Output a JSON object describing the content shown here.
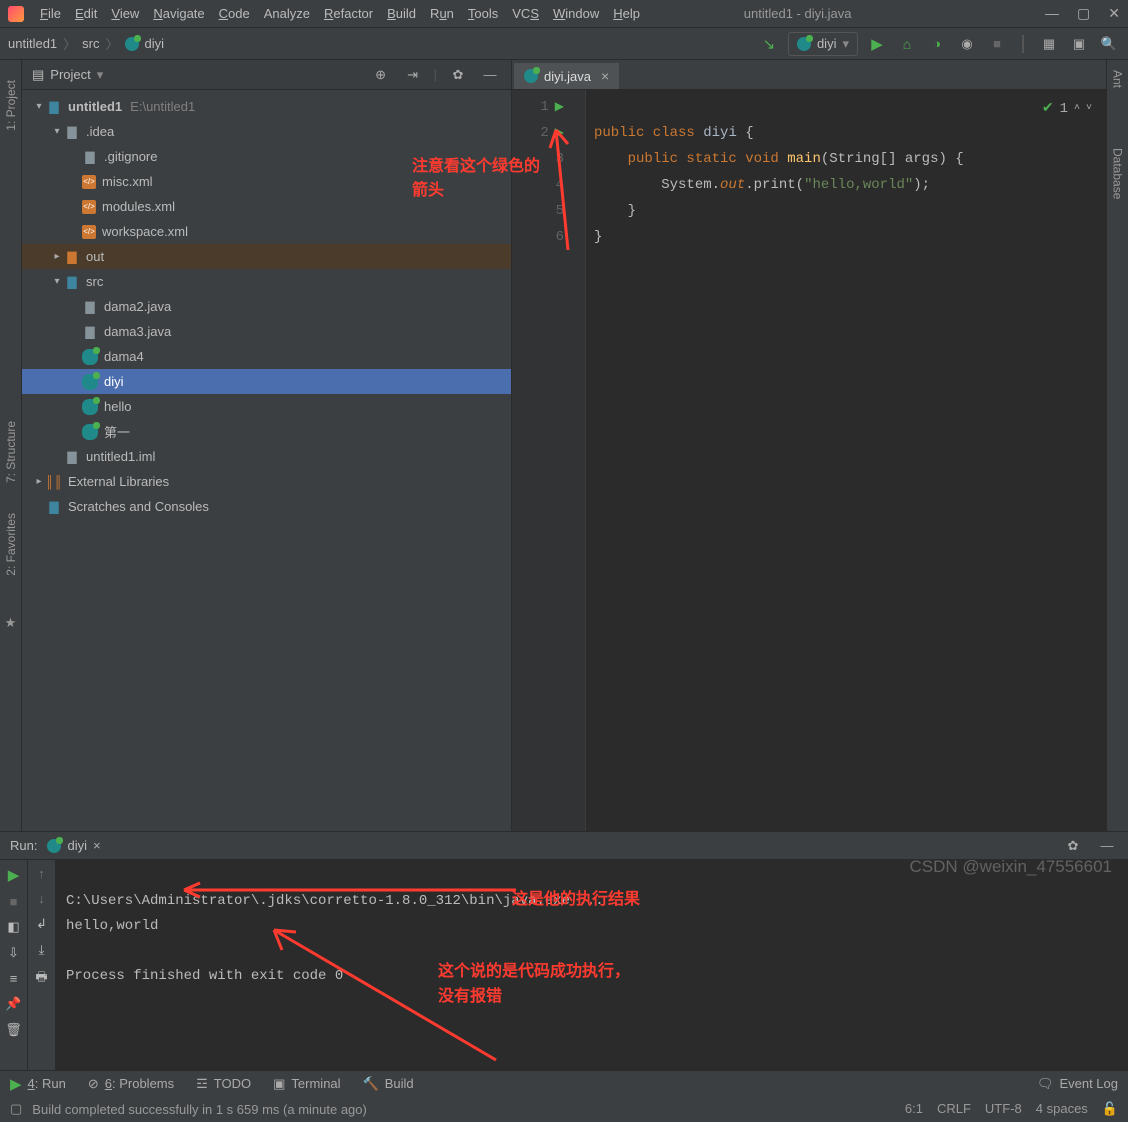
{
  "title_bar": {
    "title": "untitled1 - diyi.java"
  },
  "menus": {
    "file": "File",
    "edit": "Edit",
    "view": "View",
    "navigate": "Navigate",
    "code": "Code",
    "analyze": "Analyze",
    "refactor": "Refactor",
    "build": "Build",
    "run": "Run",
    "tools": "Tools",
    "vcs": "VCS",
    "window": "Window",
    "help": "Help"
  },
  "breadcrumb": {
    "a": "untitled1",
    "b": "src",
    "c": "diyi"
  },
  "run_config": {
    "selected": "diyi"
  },
  "project_panel": {
    "title": "Project"
  },
  "tree": {
    "root": "untitled1",
    "root_path": "E:\\untitled1",
    "idea": ".idea",
    "gitignore": ".gitignore",
    "misc": "misc.xml",
    "modules": "modules.xml",
    "workspace": "workspace.xml",
    "out": "out",
    "src": "src",
    "dama2": "dama2.java",
    "dama3": "dama3.java",
    "dama4": "dama4",
    "diyi": "diyi",
    "hello": "hello",
    "zh": "第一",
    "iml": "untitled1.iml",
    "ext": "External Libraries",
    "scratch": "Scratches and Consoles"
  },
  "tab": {
    "name": "diyi.java"
  },
  "code": {
    "l1": "public class diyi {",
    "l2": "    public static void main(String[] args) {",
    "l3": "        System.out.print(\"hello,world\");",
    "l4": "    }",
    "l5": "}",
    "l6": ""
  },
  "inspection": {
    "count": "1"
  },
  "annotations": {
    "top": "注意看这个绿色的\n箭头",
    "result": "这是他的执行结果",
    "success": "这个说的是代码成功执行，\n没有报错"
  },
  "run_panel": {
    "label": "Run:",
    "tab": "diyi",
    "line1": "C:\\Users\\Administrator\\.jdks\\corretto-1.8.0_312\\bin\\java.exe ...",
    "line2": "hello,world",
    "line3": "",
    "line4": "Process finished with exit code 0"
  },
  "tool_strip": {
    "run": "4: Run",
    "problems": "6: Problems",
    "todo": "TODO",
    "terminal": "Terminal",
    "build": "Build",
    "eventlog": "Event Log"
  },
  "status": {
    "msg": "Build completed successfully in 1 s 659 ms (a minute ago)",
    "pos": "6:1",
    "crlf": "CRLF",
    "enc": "UTF-8",
    "indent": "4 spaces"
  },
  "side_labels": {
    "project": "1: Project",
    "structure": "7: Structure",
    "favorites": "2: Favorites",
    "ant": "Ant",
    "database": "Database"
  },
  "watermark": "CSDN @weixin_47556601"
}
